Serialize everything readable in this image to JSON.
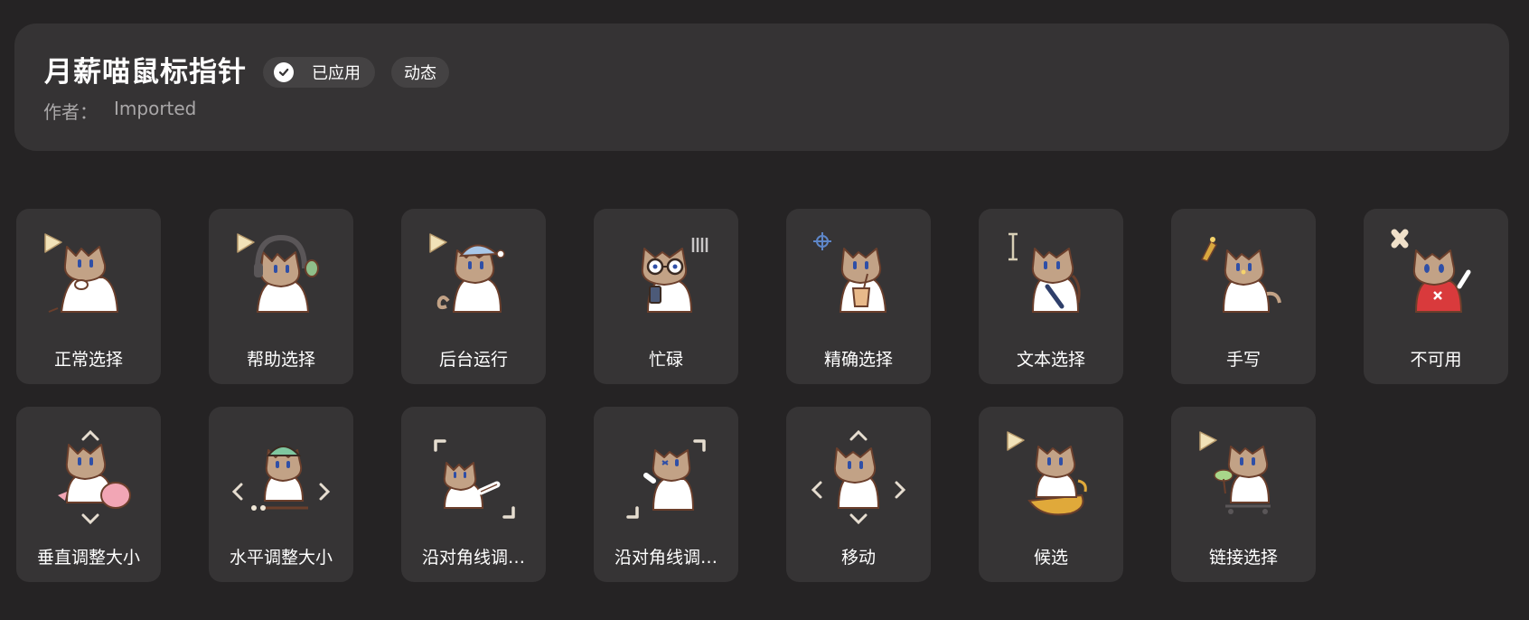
{
  "theme": {
    "title": "月薪喵鼠标指针",
    "applied_label": "已应用",
    "animated_label": "动态",
    "author_label": "作者：",
    "author_value": "Imported"
  },
  "cursors": [
    {
      "label": "正常选择",
      "icon": "arrow-pointer"
    },
    {
      "label": "帮助选择",
      "icon": "arrow-pointer-headphones"
    },
    {
      "label": "后台运行",
      "icon": "arrow-pointer-sleep-cap"
    },
    {
      "label": "忙碌",
      "icon": "busy-bars"
    },
    {
      "label": "精确选择",
      "icon": "crosshair"
    },
    {
      "label": "文本选择",
      "icon": "text-ibeam"
    },
    {
      "label": "手写",
      "icon": "pen"
    },
    {
      "label": "不可用",
      "icon": "unavailable-x"
    },
    {
      "label": "垂直调整大小",
      "icon": "resize-vertical"
    },
    {
      "label": "水平调整大小",
      "icon": "resize-horizontal"
    },
    {
      "label": "沿对角线调…",
      "icon": "resize-diagonal-1"
    },
    {
      "label": "沿对角线调…",
      "icon": "resize-diagonal-2"
    },
    {
      "label": "移动",
      "icon": "move"
    },
    {
      "label": "候选",
      "icon": "arrow-pointer-bowl"
    },
    {
      "label": "链接选择",
      "icon": "arrow-pointer-link"
    }
  ],
  "colors": {
    "background": "#252324",
    "card": "#353334",
    "tile": "#363435",
    "badge": "#444243",
    "cat_fur": "#c2a286",
    "cat_body": "#ffffff",
    "outline": "#6b3f2c",
    "eye": "#2f4fa7",
    "arrow": "#f1e2b8"
  }
}
